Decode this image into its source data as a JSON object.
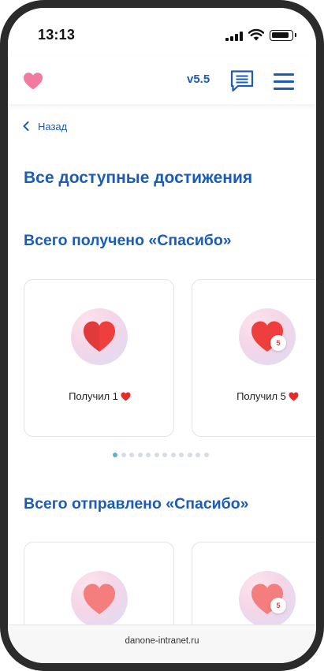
{
  "status_bar": {
    "time": "13:13"
  },
  "header": {
    "version": "v5.5",
    "logo_icon": "heart-icon",
    "chat_icon": "chat-icon",
    "menu_icon": "hamburger-menu-icon"
  },
  "back": {
    "label": "Назад",
    "icon": "chevron-left-icon"
  },
  "page_title": "Все доступные достижения",
  "received_section": {
    "title": "Всего получено «Спасибо»",
    "cards": [
      {
        "caption": "Получил 1",
        "badge_count": "",
        "heart_color": "#ef3e3e"
      },
      {
        "caption": "Получил 5",
        "badge_count": "5",
        "heart_color": "#ef3e3e"
      }
    ],
    "pagination": {
      "total": 12,
      "active_index": 0
    }
  },
  "sent_section": {
    "title": "Всего отправлено «Спасибо»",
    "cards": [
      {
        "caption": "",
        "badge_count": "",
        "heart_color": "#f47d7d"
      },
      {
        "caption": "",
        "badge_count": "5",
        "heart_color": "#f47d7d"
      }
    ]
  },
  "footer": {
    "url": "danone-intranet.ru"
  },
  "colors": {
    "brand_blue": "#1b5cb8",
    "heart_red": "#ef3e3e",
    "heart_light": "#f47d7d",
    "logo_pink": "#f27aa0",
    "dot_active": "#5bb4c8",
    "dot_inactive": "#d6dce6"
  }
}
